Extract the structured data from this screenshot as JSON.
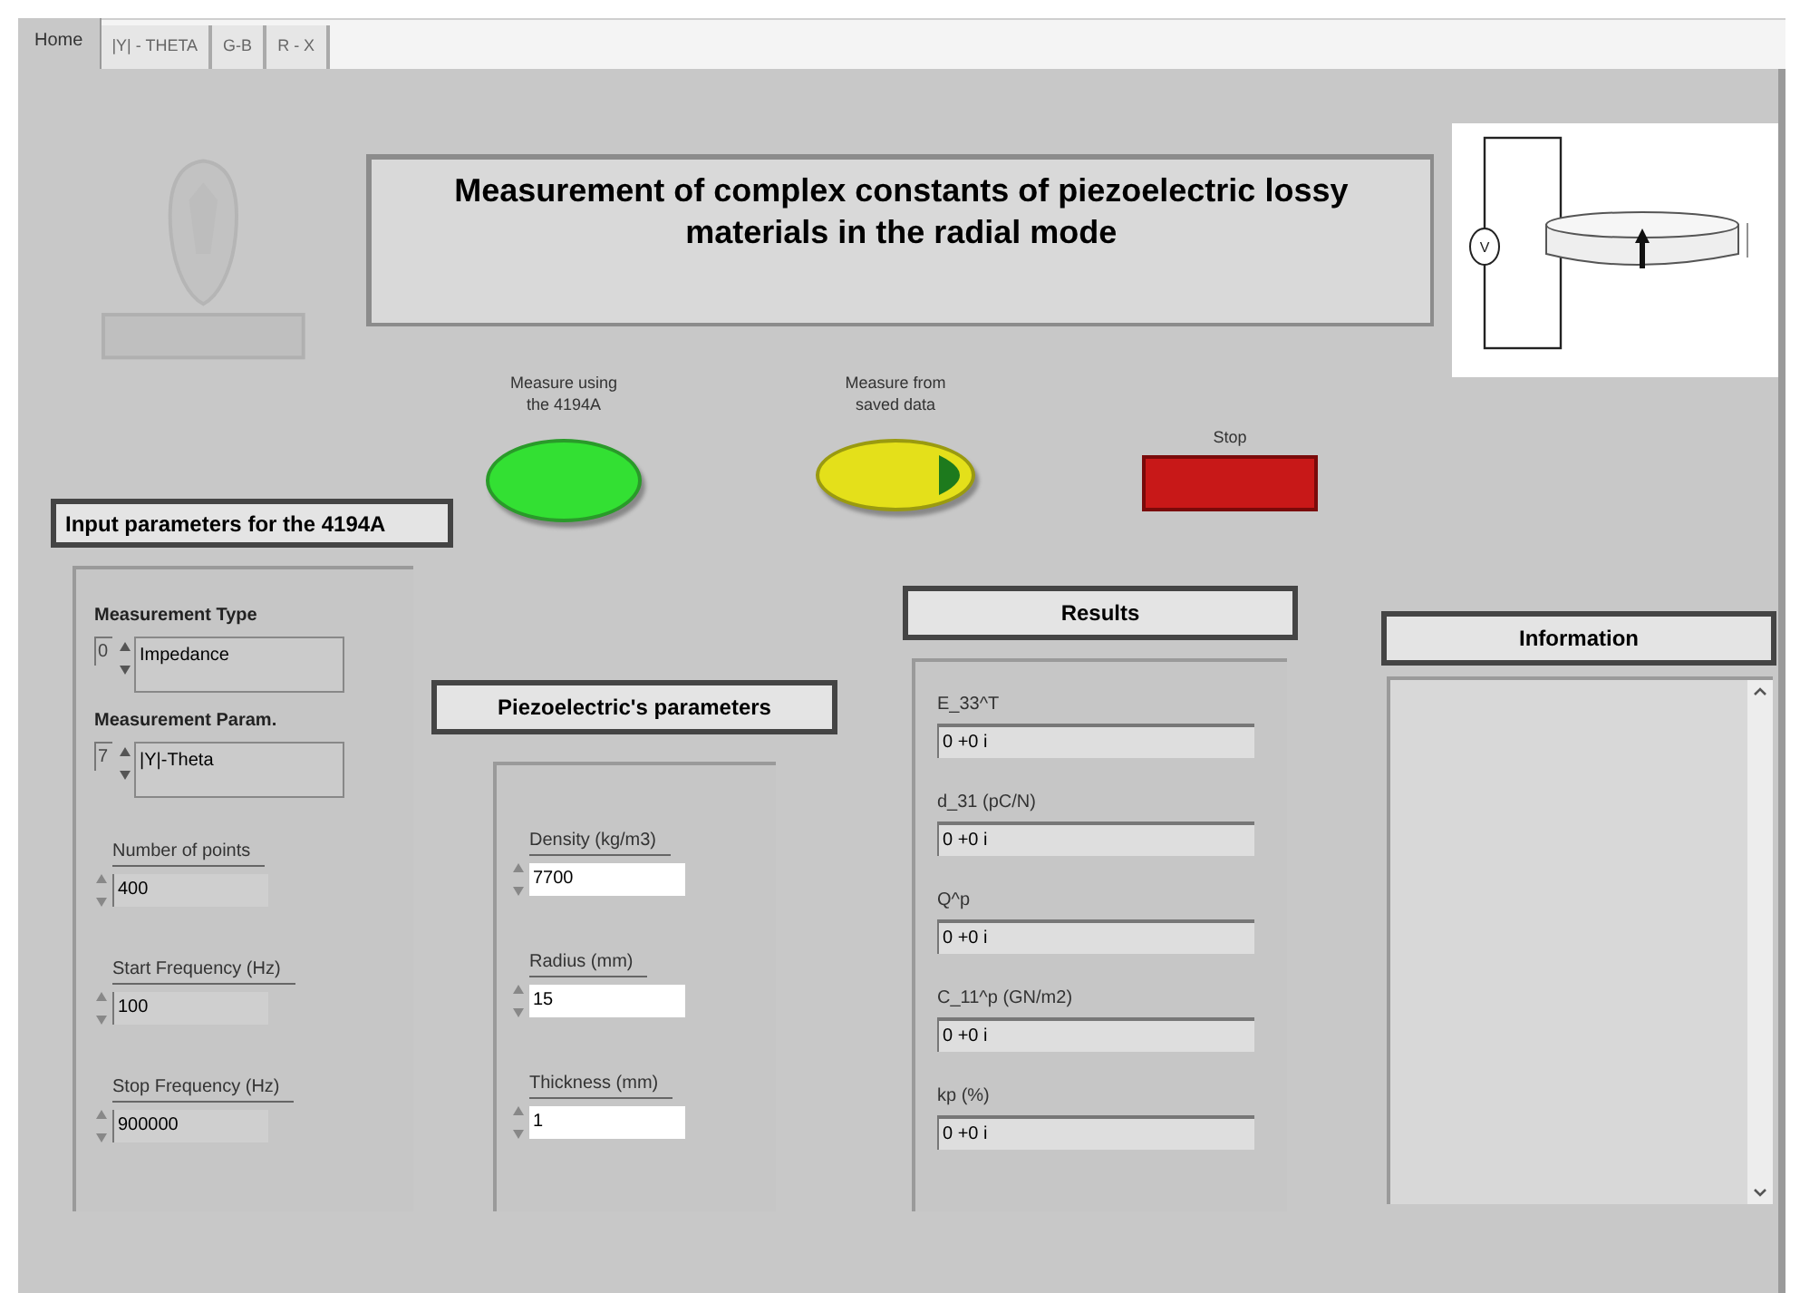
{
  "tabs": [
    {
      "label": "Home",
      "selected": true
    },
    {
      "label": "|Y| - THETA",
      "selected": false
    },
    {
      "label": "G-B",
      "selected": false
    },
    {
      "label": "R - X",
      "selected": false
    }
  ],
  "title": "Measurement of complex constants of piezoelectric lossy materials in the radial mode",
  "diagram": {
    "source_label": "V"
  },
  "buttons": [
    {
      "caption": "Measure using the 4194A",
      "kind": "green-oval"
    },
    {
      "caption": "Measure from saved data",
      "kind": "yellow-oval"
    },
    {
      "caption": "Stop",
      "kind": "red-rect"
    }
  ],
  "input_section": {
    "header": "Input parameters for the 4194A",
    "rings": [
      {
        "label": "Measurement Type",
        "index": "0",
        "value": "Impedance"
      },
      {
        "label": "Measurement Param.",
        "index": "7",
        "value": "|Y|-Theta"
      }
    ],
    "numerics": [
      {
        "label": "Number of points",
        "value": "400"
      },
      {
        "label": "Start Frequency (Hz)",
        "value": "100"
      },
      {
        "label": "Stop Frequency (Hz)",
        "value": "900000"
      }
    ]
  },
  "piezo_section": {
    "header": "Piezoelectric's parameters",
    "numerics": [
      {
        "label": "Density (kg/m3)",
        "value": "7700"
      },
      {
        "label": "Radius (mm)",
        "value": "15"
      },
      {
        "label": "Thickness (mm)",
        "value": "1"
      }
    ]
  },
  "results_section": {
    "header": "Results",
    "outputs": [
      {
        "label": "E_33^T",
        "value": "0 +0 i"
      },
      {
        "label": "d_31 (pC/N)",
        "value": "0 +0 i"
      },
      {
        "label": "Q^p",
        "value": "0 +0 i"
      },
      {
        "label": "C_11^p (GN/m2)",
        "value": "0 +0 i"
      },
      {
        "label": "kp (%)",
        "value": "0 +0 i"
      }
    ]
  },
  "information": {
    "header": "Information"
  }
}
